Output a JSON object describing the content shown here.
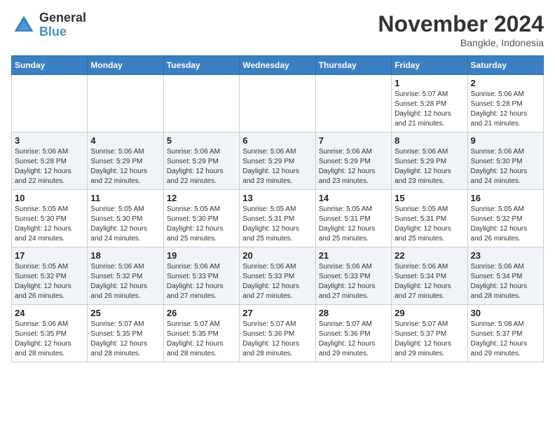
{
  "logo": {
    "general": "General",
    "blue": "Blue"
  },
  "title": {
    "month": "November 2024",
    "location": "Bangkle, Indonesia"
  },
  "headers": [
    "Sunday",
    "Monday",
    "Tuesday",
    "Wednesday",
    "Thursday",
    "Friday",
    "Saturday"
  ],
  "weeks": [
    [
      {
        "day": "",
        "info": ""
      },
      {
        "day": "",
        "info": ""
      },
      {
        "day": "",
        "info": ""
      },
      {
        "day": "",
        "info": ""
      },
      {
        "day": "",
        "info": ""
      },
      {
        "day": "1",
        "info": "Sunrise: 5:07 AM\nSunset: 5:28 PM\nDaylight: 12 hours\nand 21 minutes."
      },
      {
        "day": "2",
        "info": "Sunrise: 5:06 AM\nSunset: 5:28 PM\nDaylight: 12 hours\nand 21 minutes."
      }
    ],
    [
      {
        "day": "3",
        "info": "Sunrise: 5:06 AM\nSunset: 5:28 PM\nDaylight: 12 hours\nand 22 minutes."
      },
      {
        "day": "4",
        "info": "Sunrise: 5:06 AM\nSunset: 5:29 PM\nDaylight: 12 hours\nand 22 minutes."
      },
      {
        "day": "5",
        "info": "Sunrise: 5:06 AM\nSunset: 5:29 PM\nDaylight: 12 hours\nand 22 minutes."
      },
      {
        "day": "6",
        "info": "Sunrise: 5:06 AM\nSunset: 5:29 PM\nDaylight: 12 hours\nand 23 minutes."
      },
      {
        "day": "7",
        "info": "Sunrise: 5:06 AM\nSunset: 5:29 PM\nDaylight: 12 hours\nand 23 minutes."
      },
      {
        "day": "8",
        "info": "Sunrise: 5:06 AM\nSunset: 5:29 PM\nDaylight: 12 hours\nand 23 minutes."
      },
      {
        "day": "9",
        "info": "Sunrise: 5:06 AM\nSunset: 5:30 PM\nDaylight: 12 hours\nand 24 minutes."
      }
    ],
    [
      {
        "day": "10",
        "info": "Sunrise: 5:05 AM\nSunset: 5:30 PM\nDaylight: 12 hours\nand 24 minutes."
      },
      {
        "day": "11",
        "info": "Sunrise: 5:05 AM\nSunset: 5:30 PM\nDaylight: 12 hours\nand 24 minutes."
      },
      {
        "day": "12",
        "info": "Sunrise: 5:05 AM\nSunset: 5:30 PM\nDaylight: 12 hours\nand 25 minutes."
      },
      {
        "day": "13",
        "info": "Sunrise: 5:05 AM\nSunset: 5:31 PM\nDaylight: 12 hours\nand 25 minutes."
      },
      {
        "day": "14",
        "info": "Sunrise: 5:05 AM\nSunset: 5:31 PM\nDaylight: 12 hours\nand 25 minutes."
      },
      {
        "day": "15",
        "info": "Sunrise: 5:05 AM\nSunset: 5:31 PM\nDaylight: 12 hours\nand 25 minutes."
      },
      {
        "day": "16",
        "info": "Sunrise: 5:05 AM\nSunset: 5:32 PM\nDaylight: 12 hours\nand 26 minutes."
      }
    ],
    [
      {
        "day": "17",
        "info": "Sunrise: 5:05 AM\nSunset: 5:32 PM\nDaylight: 12 hours\nand 26 minutes."
      },
      {
        "day": "18",
        "info": "Sunrise: 5:06 AM\nSunset: 5:32 PM\nDaylight: 12 hours\nand 26 minutes."
      },
      {
        "day": "19",
        "info": "Sunrise: 5:06 AM\nSunset: 5:33 PM\nDaylight: 12 hours\nand 27 minutes."
      },
      {
        "day": "20",
        "info": "Sunrise: 5:06 AM\nSunset: 5:33 PM\nDaylight: 12 hours\nand 27 minutes."
      },
      {
        "day": "21",
        "info": "Sunrise: 5:06 AM\nSunset: 5:33 PM\nDaylight: 12 hours\nand 27 minutes."
      },
      {
        "day": "22",
        "info": "Sunrise: 5:06 AM\nSunset: 5:34 PM\nDaylight: 12 hours\nand 27 minutes."
      },
      {
        "day": "23",
        "info": "Sunrise: 5:06 AM\nSunset: 5:34 PM\nDaylight: 12 hours\nand 28 minutes."
      }
    ],
    [
      {
        "day": "24",
        "info": "Sunrise: 5:06 AM\nSunset: 5:35 PM\nDaylight: 12 hours\nand 28 minutes."
      },
      {
        "day": "25",
        "info": "Sunrise: 5:07 AM\nSunset: 5:35 PM\nDaylight: 12 hours\nand 28 minutes."
      },
      {
        "day": "26",
        "info": "Sunrise: 5:07 AM\nSunset: 5:35 PM\nDaylight: 12 hours\nand 28 minutes."
      },
      {
        "day": "27",
        "info": "Sunrise: 5:07 AM\nSunset: 5:36 PM\nDaylight: 12 hours\nand 28 minutes."
      },
      {
        "day": "28",
        "info": "Sunrise: 5:07 AM\nSunset: 5:36 PM\nDaylight: 12 hours\nand 29 minutes."
      },
      {
        "day": "29",
        "info": "Sunrise: 5:07 AM\nSunset: 5:37 PM\nDaylight: 12 hours\nand 29 minutes."
      },
      {
        "day": "30",
        "info": "Sunrise: 5:08 AM\nSunset: 5:37 PM\nDaylight: 12 hours\nand 29 minutes."
      }
    ]
  ]
}
